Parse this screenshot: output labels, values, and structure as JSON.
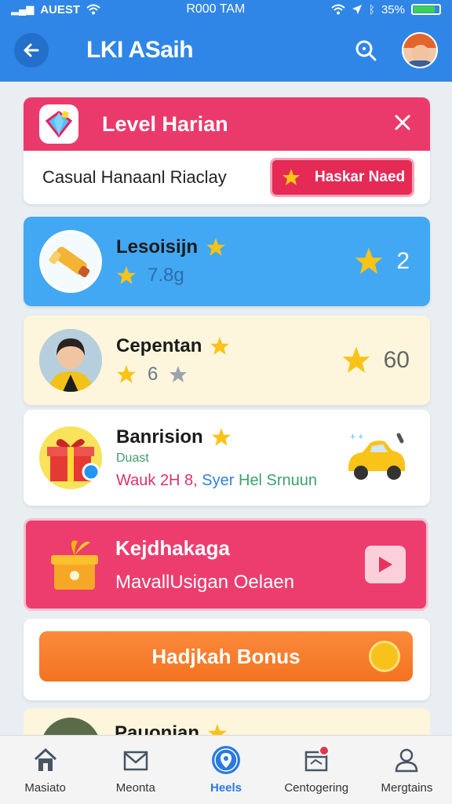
{
  "status_bar": {
    "carrier": "AUEST",
    "time": "R000 TAM",
    "battery": "35%"
  },
  "header": {
    "title": "LKI ASaih"
  },
  "level_card": {
    "title": "Level Harian",
    "subtitle": "Casual Hanaanl Riaclay",
    "button_label": "Haskar Naed"
  },
  "rows": [
    {
      "name": "Lesoisijn",
      "meta": "7.8g",
      "score": "2"
    },
    {
      "name": "Cepentan",
      "meta": "6",
      "score": "60"
    },
    {
      "name": "Banrision",
      "sub1": "Duast",
      "sub2_a": "Wauk 2H 8,",
      "sub2_b": " Syer",
      "sub2_c": " Hel Srnuun"
    }
  ],
  "promo": {
    "title": "Kejdhakaga",
    "subtitle": "MavallUsigan Oelaen"
  },
  "bonus": {
    "button_label": "Hadjkah Bonus"
  },
  "peek_card": {
    "name": "Pauonian"
  },
  "bottom_nav": [
    {
      "label": "Masiato",
      "icon": "home-icon"
    },
    {
      "label": "Meonta",
      "icon": "mail-icon"
    },
    {
      "label": "Heels",
      "icon": "map-pin-icon",
      "active": true
    },
    {
      "label": "Centogering",
      "icon": "calendar-icon"
    },
    {
      "label": "Mergtains",
      "icon": "person-icon"
    }
  ],
  "colors": {
    "header_blue": "#2f86e6",
    "pink": "#ea3a6b",
    "row_blue": "#43a8f3",
    "cream": "#fdf6dc",
    "orange": "#f4731f",
    "star": "#f9c318",
    "nav_active": "#2a7ae2"
  }
}
